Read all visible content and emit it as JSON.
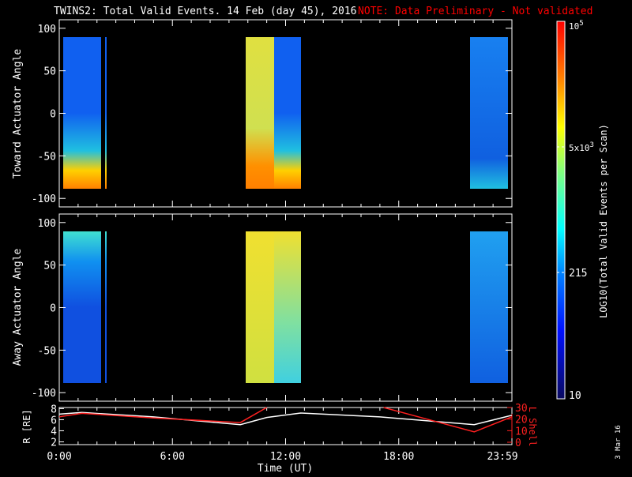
{
  "title": "TWINS2: Total Valid Events. 14 Feb (day  45), 2016",
  "note": "NOTE: Data Preliminary - Not validated",
  "date_stamp": "3 Mar 16",
  "colors": {
    "background": "#000000",
    "axes": "#ffffff",
    "note": "#ff0000",
    "lshell": "#ff2020",
    "r": "#ffffff"
  },
  "chart_data": [
    {
      "type": "heatmap",
      "name": "toward",
      "ylabel": "Toward Actuator Angle",
      "ylim": [
        -110,
        110
      ],
      "yticks": [
        100,
        50,
        0,
        -50,
        -100
      ],
      "xlim": [
        0,
        24
      ],
      "coverage_hours": [
        [
          0.2,
          2.2
        ],
        [
          2.45,
          2.55
        ],
        [
          9.8,
          12.8
        ],
        [
          21.7,
          23.8
        ]
      ],
      "profile": "high counts near -88 deg in first interval; yellow/orange across middle interval; blue/cyan in last"
    },
    {
      "type": "heatmap",
      "name": "away",
      "ylabel": "Away Actuator Angle",
      "ylim": [
        -110,
        110
      ],
      "yticks": [
        100,
        50,
        0,
        -50,
        -100
      ],
      "xlim": [
        0,
        24
      ],
      "coverage_hours": [
        [
          0.2,
          2.2
        ],
        [
          2.45,
          2.55
        ],
        [
          9.8,
          12.8
        ],
        [
          21.7,
          23.8
        ]
      ]
    },
    {
      "type": "line",
      "name": "ephemeris",
      "xlabel": "Time (UT)",
      "xticks": [
        "0:00",
        "6:00",
        "12:00",
        "18:00",
        "23:59"
      ],
      "ylabel": "R [RE]",
      "yticks": [
        "8",
        "6",
        "4",
        "2"
      ],
      "ylim": [
        1.5,
        8.2
      ],
      "y2label": "L Shell",
      "y2ticks": [
        "30",
        "20",
        "10",
        "0"
      ],
      "y2lim": [
        0,
        30
      ],
      "series": [
        {
          "name": "R",
          "axis": "left",
          "x": [
            0,
            1.2,
            5,
            9.6,
            11,
            12.8,
            17,
            22,
            24
          ],
          "y": [
            7.0,
            7.3,
            6.5,
            5.1,
            6.4,
            7.2,
            6.5,
            5.1,
            6.8
          ]
        },
        {
          "name": "L Shell",
          "axis": "right",
          "segments": [
            {
              "x": [
                0,
                1.2,
                5,
                9.6,
                11
              ],
              "y": [
                22,
                25,
                21,
                17,
                30
              ]
            },
            {
              "x": [
                17.2,
                22,
                24
              ],
              "y": [
                30,
                9,
                22
              ]
            }
          ]
        }
      ]
    },
    {
      "type": "colorbar",
      "label": "LOG10(Total Valid Events per Scan)",
      "ticks": [
        "10^5",
        "5x10^3",
        "215",
        "10"
      ],
      "range": [
        10,
        100000
      ]
    }
  ]
}
